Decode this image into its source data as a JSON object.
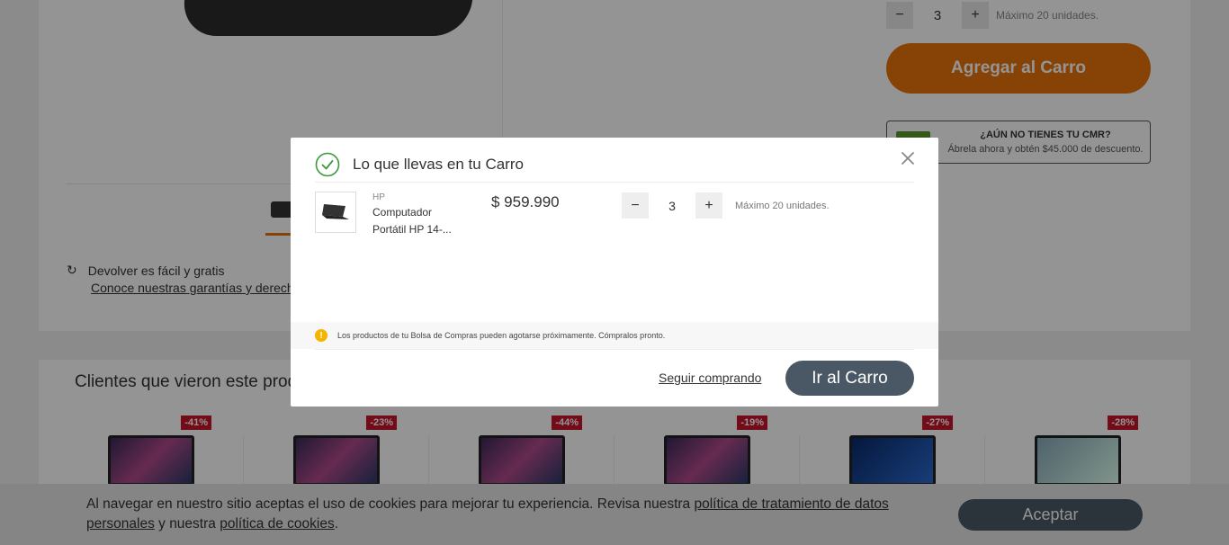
{
  "product": {
    "quantity": "3",
    "max_units": "Máximo 20 unidades.",
    "add_to_cart": "Agregar al Carro",
    "cmr_title": "¿AÚN NO TIENES TU CMR?",
    "cmr_subtitle": "Ábrela ahora y obtén $45.000 de descuento.",
    "return_text": "Devolver es fácil y gratis",
    "return_link": "Conoce nuestras garantías y derechos"
  },
  "recommendations": {
    "title": "Clientes que vieron este producto",
    "discounts": [
      "-41%",
      "-23%",
      "-44%",
      "-19%",
      "-27%",
      "-28%"
    ]
  },
  "modal": {
    "title": "Lo que llevas en tu Carro",
    "item": {
      "brand": "HP",
      "name": "Computador Portátil HP 14-...",
      "price": "$ 959.990",
      "quantity": "3",
      "max_units": "Máximo 20 unidades."
    },
    "warning": "Los productos de tu Bolsa de Compras pueden agotarse próximamente. Cómpralos pronto.",
    "continue_label": "Seguir comprando",
    "go_cart_label": "Ir al Carro"
  },
  "cookie": {
    "text_1": "Al navegar en nuestro sitio aceptas el uso de cookies para mejorar tu experiencia. Revisa nuestra ",
    "link_1": "política de tratamiento de datos personales",
    "text_2": " y nuestra ",
    "link_2": "política de cookies",
    "text_3": ".",
    "accept_label": "Aceptar"
  },
  "colors": {
    "accent": "#e8730c",
    "dark_button": "#4a5866",
    "discount": "#c7132b",
    "success": "#3a9a3a",
    "warning": "#f5b400"
  }
}
